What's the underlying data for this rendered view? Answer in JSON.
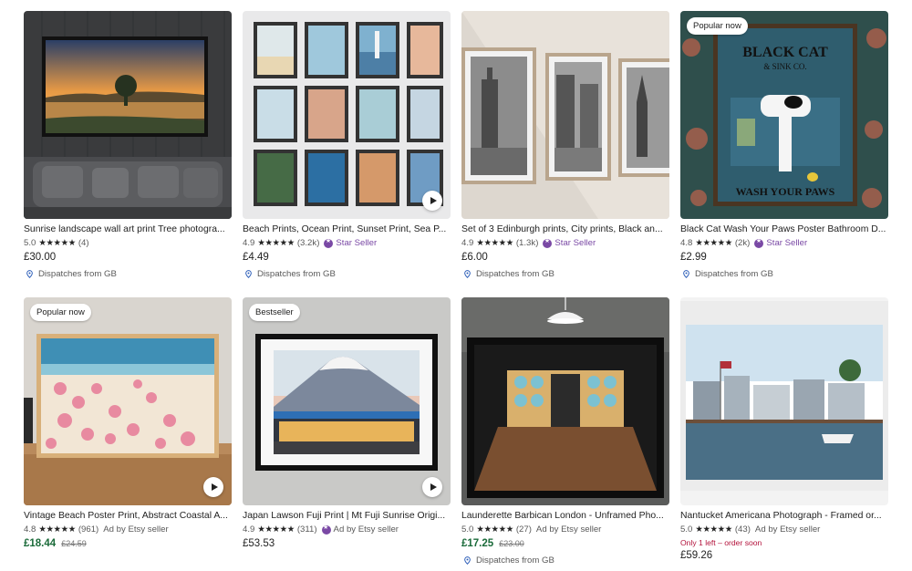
{
  "products": [
    {
      "title": "Sunrise landscape wall art print Tree photogra...",
      "rating": "5.0",
      "stars": "★★★★★",
      "reviews": "(4)",
      "price": "£30.00",
      "dispatch": "Dispatches from GB"
    },
    {
      "title": "Beach Prints, Ocean Print, Sunset Print, Sea P...",
      "rating": "4.9",
      "stars": "★★★★★",
      "reviews": "(3.2k)",
      "seller": "Star Seller",
      "price": "£4.49",
      "dispatch": "Dispatches from GB"
    },
    {
      "title": "Set of 3 Edinburgh prints, City prints, Black an...",
      "rating": "4.9",
      "stars": "★★★★★",
      "reviews": "(1.3k)",
      "seller": "Star Seller",
      "price": "£6.00",
      "dispatch": "Dispatches from GB"
    },
    {
      "badge": "Popular now",
      "title": "Black Cat Wash Your Paws Poster Bathroom D...",
      "rating": "4.8",
      "stars": "★★★★★",
      "reviews": "(2k)",
      "seller": "Star Seller",
      "price": "£2.99",
      "dispatch": "Dispatches from GB",
      "poster_text": {
        "line1": "BLACK CAT",
        "line2": "& SINK CO.",
        "line3": "WASH YOUR PAWS"
      }
    },
    {
      "badge": "Popular now",
      "title": "Vintage Beach Poster Print, Abstract Coastal A...",
      "rating": "4.8",
      "stars": "★★★★★",
      "reviews": "(961)",
      "ad": "Ad by Etsy seller",
      "price": "£18.44",
      "original_price": "£24.59"
    },
    {
      "badge": "Bestseller",
      "title": "Japan Lawson Fuji Print | Mt Fuji Sunrise Origi...",
      "rating": "4.9",
      "stars": "★★★★★",
      "reviews": "(311)",
      "seller": "Ad by Etsy seller",
      "price": "£53.53"
    },
    {
      "title": "Launderette Barbican London - Unframed Pho...",
      "rating": "5.0",
      "stars": "★★★★★",
      "reviews": "(27)",
      "ad": "Ad by Etsy seller",
      "price": "£17.25",
      "original_price": "£23.00",
      "dispatch": "Dispatches from GB"
    },
    {
      "title": "Nantucket Americana Photograph - Framed or...",
      "rating": "5.0",
      "stars": "★★★★★",
      "reviews": "(43)",
      "ad": "Ad by Etsy seller",
      "stock": "Only 1 left – order soon",
      "price": "£59.26"
    }
  ],
  "icons": {
    "play": "play-icon",
    "pin": "location-pin-icon",
    "star_seller": "star-seller-medal-icon"
  },
  "colors": {
    "star_seller": "#7a49a5",
    "sale_price": "#1b6b3a",
    "stock_warning": "#b3123b"
  }
}
